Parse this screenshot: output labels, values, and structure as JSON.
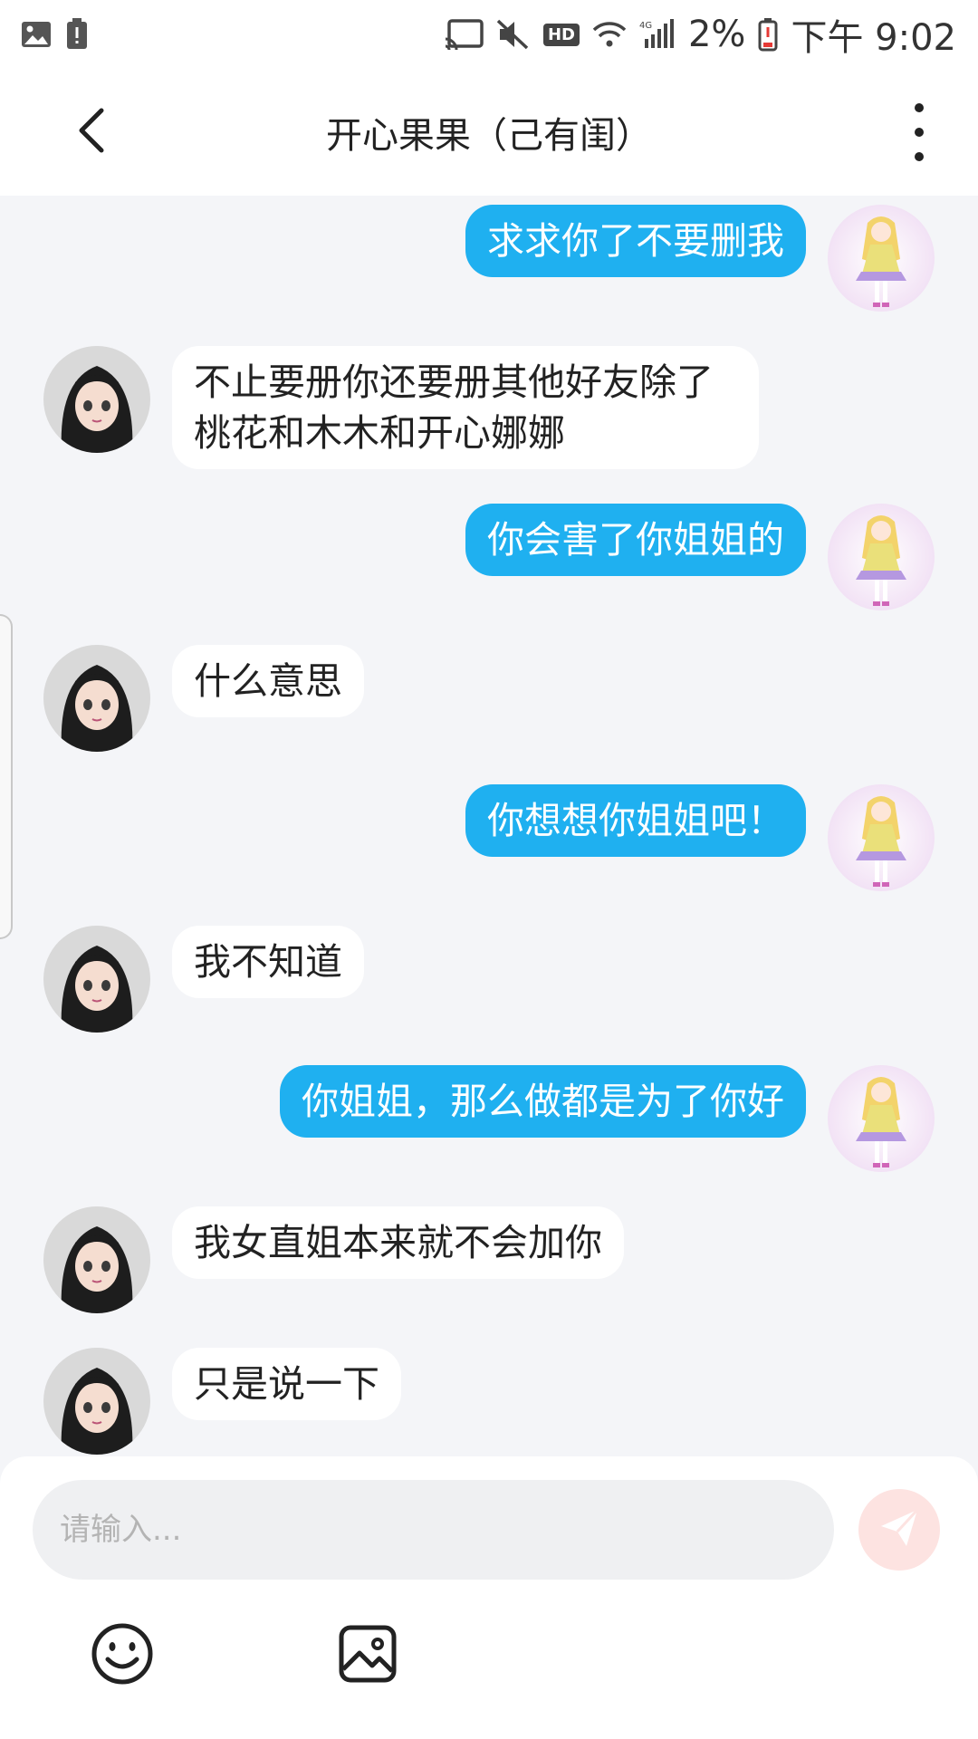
{
  "status_bar": {
    "battery_percent": "2%",
    "time": "下午 9:02",
    "hd_label": "HD",
    "network_label": "4G"
  },
  "header": {
    "title": "开心果果（己有闺）"
  },
  "messages": [
    {
      "side": "right",
      "text": "求求你了不要删我",
      "avatar": "anime-doll-avatar"
    },
    {
      "side": "left",
      "text": "不止要册你还要册其他好友除了桃花和木木和开心娜娜",
      "avatar": "dark-hair-girl-avatar"
    },
    {
      "side": "right",
      "text": "你会害了你姐姐的",
      "avatar": "anime-doll-avatar"
    },
    {
      "side": "left",
      "text": "什么意思",
      "avatar": "dark-hair-girl-avatar"
    },
    {
      "side": "right",
      "text": "你想想你姐姐吧！",
      "avatar": "anime-doll-avatar"
    },
    {
      "side": "left",
      "text": "我不知道",
      "avatar": "dark-hair-girl-avatar"
    },
    {
      "side": "right",
      "text": "你姐姐，那么做都是为了你好",
      "avatar": "anime-doll-avatar"
    },
    {
      "side": "left",
      "text": "我女直姐本来就不会加你",
      "avatar": "dark-hair-girl-avatar"
    },
    {
      "side": "left",
      "text": "只是说一下",
      "avatar": "dark-hair-girl-avatar"
    }
  ],
  "input": {
    "placeholder": "请输入...",
    "value": ""
  },
  "colors": {
    "sent_bubble": "#1fb0f0",
    "received_bubble": "#ffffff",
    "background": "#f4f5f8",
    "send_button": "#fde3e1"
  },
  "icons": {
    "back": "back-arrow-icon",
    "more": "more-vertical-icon",
    "send": "send-icon",
    "emoji": "emoji-icon",
    "image": "image-icon"
  }
}
